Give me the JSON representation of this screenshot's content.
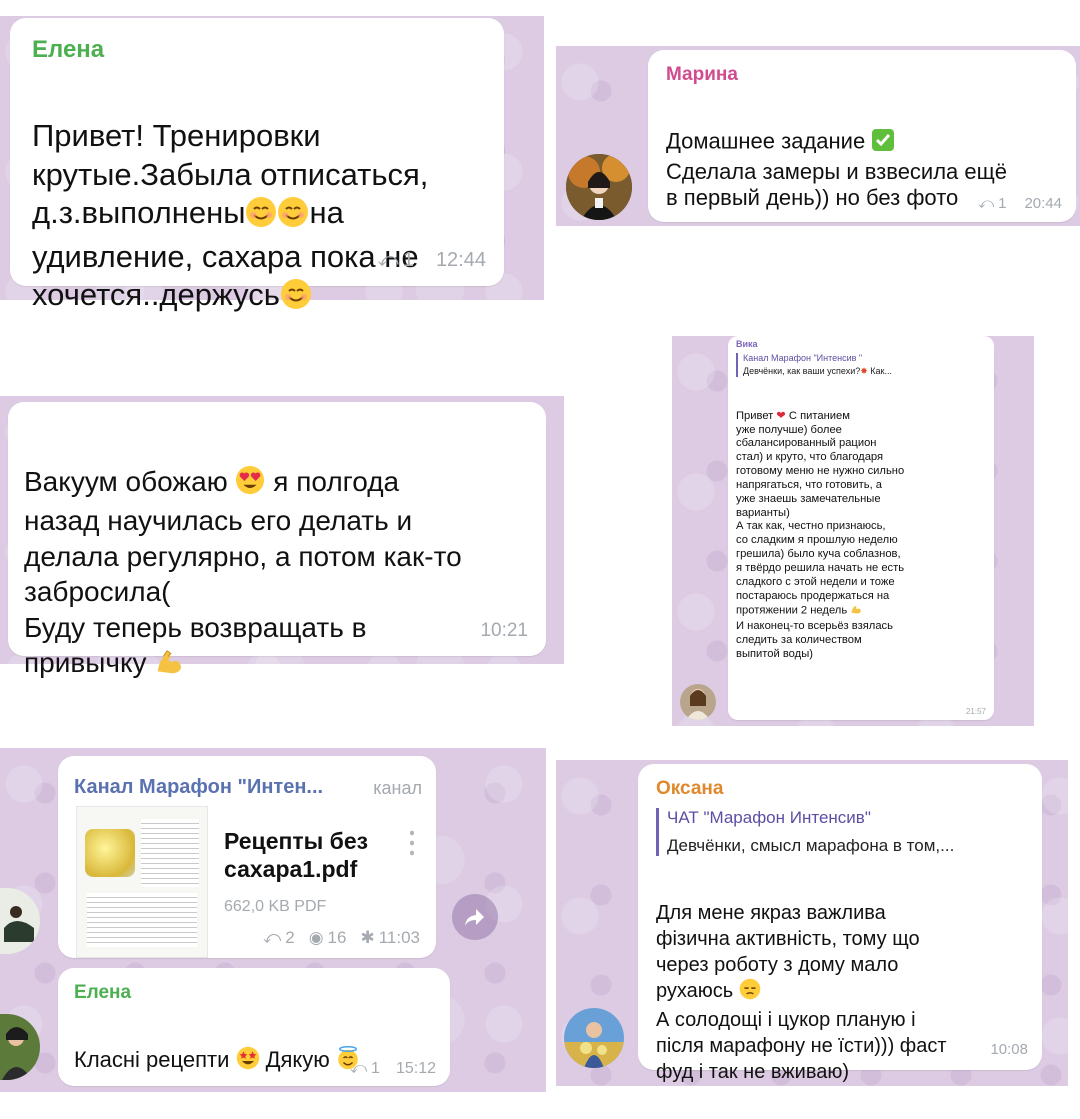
{
  "screens": {
    "elena1": {
      "name": "Елена",
      "text": "Привет! Тренировки\nкрутые.Забыла отписаться,\nд.з.выполнены",
      "text_after_smiles": "на\nудивление, сахара пока не\nхочется..держусь",
      "reply_count": "1",
      "time": "12:44"
    },
    "marina": {
      "name": "Марина",
      "line1": "Домашнее задание",
      "text": "Сделала замеры и взвесила ещё\nв первый день)) но без фото",
      "reply_count": "1",
      "time": "20:44"
    },
    "vacuum": {
      "text_a": "Вакуум обожаю",
      "text_b": " я полгода\nназад научилась его делать и\nделала регулярно, а потом как-то\nзабросила(\nБуду теперь возвращать в\nпривычку",
      "time": "10:21"
    },
    "vika": {
      "name": "Вика",
      "quote_title": "Канал Марафон \"Интенсив \"",
      "quote_text": "Девчёнки, как ваши успехи?",
      "quote_tail": " Как...",
      "text_a": "Привет",
      "text_b": " С питанием\nуже получше) более\nсбалансированный рацион\nстал) и круто, что благодаря\nготовому меню не нужно сильно\nнапрягаться, что готовить, а\nуже знаешь замечательные\nварианты)\nА так как, честно признаюсь,\nсо сладким я прошлую неделю\nгрешила) было куча соблазнов,\nя твёрдо решила начать не есть\nсладкого с этой недели и тоже\nпостараюсь продержаться на\nпротяжении 2 недель",
      "text_c": "\nИ наконец-то всерьёз взялась\nследить за количеством\nвыпитой воды)",
      "time": "21:57"
    },
    "channel": {
      "title": "Канал Марафон \"Интен...",
      "badge": "канал",
      "file_name": "Рецепты без\nсахара1.pdf",
      "file_size": "662,0 KB PDF",
      "replies": "2",
      "views": "16",
      "time": "11:03"
    },
    "elena2": {
      "name": "Елена",
      "text_a": "Класні рецепти",
      "text_b": " Дякую",
      "reply_count": "1",
      "time": "15:12"
    },
    "oksana": {
      "name": "Оксана",
      "quote_title": "ЧАТ \"Марафон Интенсив\"",
      "quote_text": "Девчёнки, смысл марафона в том,...",
      "text_a": "Для мене якраз важлива\nфізична активність, тому що\nчерез роботу з дому мало\nрухаюсь",
      "text_b": "\nА солодощі і цукор планую і\nпісля марафону не їсти))) фаст\nфуд і так не вживаю)",
      "time": "10:08"
    }
  },
  "colors": {
    "panel": "#dccbe3",
    "name_green": "#4caf50",
    "name_pink": "#d14b8f",
    "name_purple": "#7a67b8",
    "name_orange": "#e0892c",
    "channel_blue": "#5b72b0",
    "meta_gray": "#a4aab0"
  }
}
